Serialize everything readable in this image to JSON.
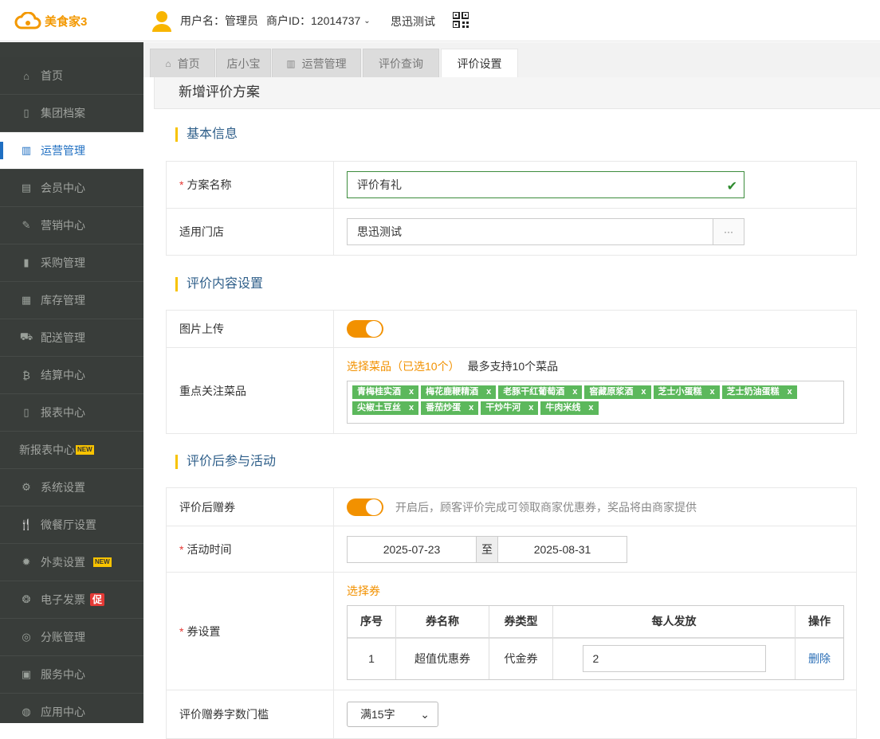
{
  "header": {
    "logo_text": "美食家3",
    "user_label": "用户名：管理员",
    "merchant_label": "商户ID：12014737",
    "store_name": "思迅测试"
  },
  "sidebar": {
    "items": [
      {
        "label": "首页",
        "icon": "home-icon"
      },
      {
        "label": "集团档案",
        "icon": "file-icon"
      },
      {
        "label": "运营管理",
        "icon": "bar-chart-icon"
      },
      {
        "label": "会员中心",
        "icon": "id-card-icon"
      },
      {
        "label": "营销中心",
        "icon": "edit-icon"
      },
      {
        "label": "采购管理",
        "icon": "book-icon"
      },
      {
        "label": "库存管理",
        "icon": "building-icon"
      },
      {
        "label": "配送管理",
        "icon": "truck-icon"
      },
      {
        "label": "结算中心",
        "icon": "bitcoin-icon"
      },
      {
        "label": "报表中心",
        "icon": "report-icon"
      },
      {
        "label": "新报表中心",
        "badge": "NEW"
      },
      {
        "label": "系统设置",
        "icon": "cogs-icon"
      },
      {
        "label": "微餐厅设置",
        "icon": "cutlery-icon"
      },
      {
        "label": "外卖设置",
        "icon": "gear-icon",
        "badge": "NEW"
      },
      {
        "label": "电子发票",
        "icon": "invoice-icon",
        "badge": "促"
      },
      {
        "label": "分账管理",
        "icon": "split-icon"
      },
      {
        "label": "服务中心",
        "icon": "service-icon"
      },
      {
        "label": "应用中心",
        "icon": "app-icon"
      }
    ]
  },
  "tabs": [
    {
      "label": "首页"
    },
    {
      "label": "店小宝"
    },
    {
      "label": "运营管理"
    },
    {
      "label": "评价查询"
    },
    {
      "label": "评价设置"
    }
  ],
  "page": {
    "title": "新增评价方案",
    "sections": {
      "basic": "基本信息",
      "content": "评价内容设置",
      "activity": "评价后参与活动"
    },
    "plan_name": {
      "label": "方案名称",
      "value": "评价有礼"
    },
    "store": {
      "label": "适用门店",
      "value": "思迅测试",
      "btn": "···"
    },
    "photo_upload": {
      "label": "图片上传"
    },
    "focus_dishes": {
      "label": "重点关注菜品",
      "select_link": "选择菜品（已选10个）",
      "hint": "最多支持10个菜品",
      "tags": [
        "青梅桂实酒",
        "梅花鹿鞭精酒",
        "老豚干红葡萄酒",
        "窖藏原浆酒",
        "芝士小蛋糕",
        "芝士奶油蛋糕",
        "尖椒土豆丝",
        "番茄炒蛋",
        "干炒牛河",
        "牛肉米线"
      ],
      "tag_close": "x"
    },
    "gift": {
      "label": "评价后赠券",
      "hint": "开启后，顾客评价完成可领取商家优惠券，奖品将由商家提供"
    },
    "activity_time": {
      "label": "活动时间",
      "start": "2025-07-23",
      "sep": "至",
      "end": "2025-08-31"
    },
    "coupon": {
      "label": "券设置",
      "select_link": "选择券",
      "headers": [
        "序号",
        "券名称",
        "券类型",
        "每人发放",
        "操作"
      ],
      "rows": [
        {
          "no": "1",
          "name": "超值优惠券",
          "type": "代金券",
          "qty": "2",
          "action": "删除"
        }
      ]
    },
    "threshold": {
      "label": "评价赠券字数门槛",
      "value": "满15字"
    }
  },
  "colors": {
    "accent": "#f29100",
    "active": "#1f6fc2",
    "sidebar": "#393d3a",
    "tag": "#5cb85c"
  }
}
